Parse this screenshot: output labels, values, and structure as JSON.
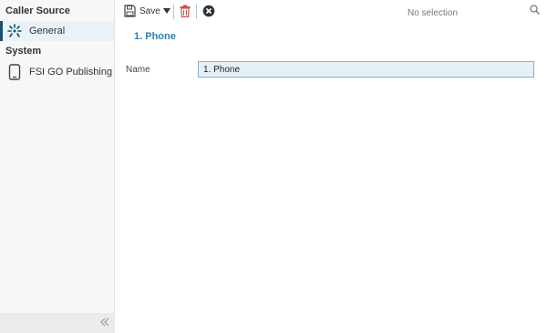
{
  "sidebar": {
    "sections": [
      {
        "title": "Caller Source",
        "items": [
          {
            "label": "General",
            "icon": "spark-icon",
            "active": true
          }
        ]
      },
      {
        "title": "System",
        "items": [
          {
            "label": "FSI GO Publishing",
            "icon": "phone-icon",
            "active": false
          }
        ]
      }
    ],
    "collapse_icon": "double-chevron-left-icon"
  },
  "toolbar": {
    "save_label": "Save",
    "search_placeholder": "No selection"
  },
  "form": {
    "title": "1. Phone",
    "fields": [
      {
        "label": "Name",
        "value": "1. Phone"
      }
    ]
  },
  "colors": {
    "accent": "#2a82b5",
    "active_bar": "#1a4d6e",
    "delete_red": "#c0504d",
    "input_bg": "#e6f1f7"
  }
}
